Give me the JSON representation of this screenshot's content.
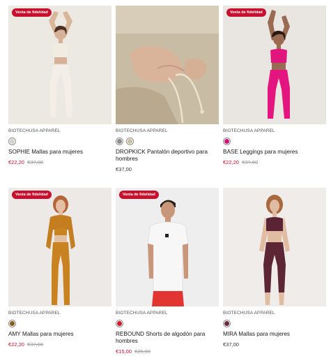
{
  "badge_label": "Venta de fidelidad",
  "products": [
    {
      "brand": "BIOTECHUSA APPAREL",
      "name": "SOPHIE Mallas para mujeres",
      "price_sale": "€22,20",
      "price_old": "€37,00",
      "swatches": [
        {
          "color": "#d6d1c7",
          "name": "cream"
        }
      ],
      "badge": true
    },
    {
      "brand": "BIOTECHUSA APPAREL",
      "name": "DROPKICK Pantalón deportivo para hombres",
      "price_regular": "€37,00",
      "swatches": [
        {
          "color": "#8c8c8c",
          "name": "grey"
        },
        {
          "color": "#c9c09a",
          "name": "beige"
        }
      ],
      "badge": false
    },
    {
      "brand": "BIOTECHUSA APPAREL",
      "name": "BASE Leggings para mujeres",
      "price_sale": "€22,20",
      "price_old": "€37,00",
      "swatches": [
        {
          "color": "#d1127a",
          "name": "pink"
        }
      ],
      "badge": true
    },
    {
      "brand": "BIOTECHUSA APPAREL",
      "name": "AMY Mallas para mujeres",
      "price_sale": "€22,20",
      "price_old": "€37,00",
      "swatches": [
        {
          "color": "#8a5a1e",
          "name": "ochre"
        }
      ],
      "badge": true
    },
    {
      "brand": "BIOTECHUSA APPAREL",
      "name": "REBOUND Shorts de algodón para hombres",
      "price_sale": "€15,00",
      "price_old": "€25,00",
      "swatches": [
        {
          "color": "#d01a2a",
          "name": "red"
        }
      ],
      "badge": true
    },
    {
      "brand": "BIOTECHUSA APPAREL",
      "name": "MIRA Mallas para mujeres",
      "price_regular": "€37,00",
      "swatches": [
        {
          "color": "#6d2b3a",
          "name": "burgundy"
        }
      ],
      "badge": false
    }
  ],
  "colors": {
    "sale": "#c8102e",
    "badge_bg": "#c8102e"
  }
}
